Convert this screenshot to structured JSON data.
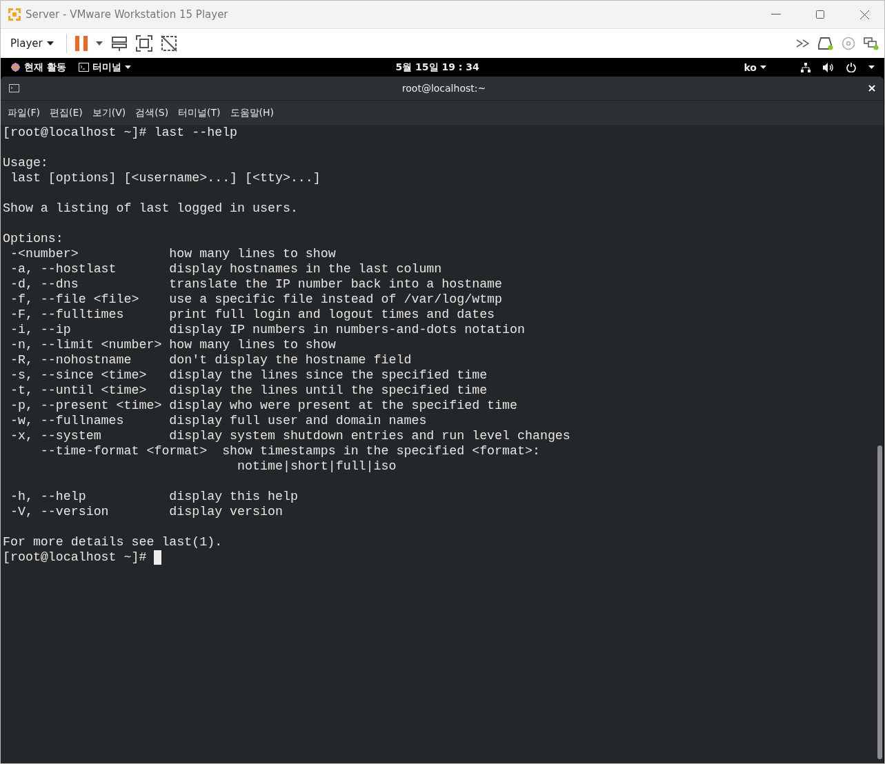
{
  "window": {
    "title": "Server - VMware Workstation 15 Player"
  },
  "toolbar": {
    "menu": "Player"
  },
  "top_bar": {
    "activities": "현재 활동",
    "app": "터미널",
    "clock": "5월 15일  19 : 34",
    "language": "ko"
  },
  "terminal": {
    "title": "root@localhost:~",
    "menu": [
      "파일(F)",
      "편집(E)",
      "보기(V)",
      "검색(S)",
      "터미널(T)",
      "도움말(H)"
    ],
    "blocks": [
      [
        "[root@localhost ~]# last --help"
      ],
      [
        "Usage:",
        " last [options] [<username>...] [<tty>...]"
      ],
      [
        "Show a listing of last logged in users."
      ],
      [
        "Options:",
        " -<number>            how many lines to show",
        " -a, --hostlast       display hostnames in the last column",
        " -d, --dns            translate the IP number back into a hostname",
        " -f, --file <file>    use a specific file instead of /var/log/wtmp",
        " -F, --fulltimes      print full login and logout times and dates",
        " -i, --ip             display IP numbers in numbers-and-dots notation",
        " -n, --limit <number> how many lines to show",
        " -R, --nohostname     don't display the hostname field",
        " -s, --since <time>   display the lines since the specified time",
        " -t, --until <time>   display the lines until the specified time",
        " -p, --present <time> display who were present at the specified time",
        " -w, --fullnames      display full user and domain names",
        " -x, --system         display system shutdown entries and run level changes",
        "     --time-format <format>  show timestamps in the specified <format>:",
        "                               notime|short|full|iso"
      ],
      [
        " -h, --help           display this help",
        " -V, --version        display version"
      ],
      [
        "For more details see last(1).",
        "[root@localhost ~]# "
      ]
    ]
  }
}
